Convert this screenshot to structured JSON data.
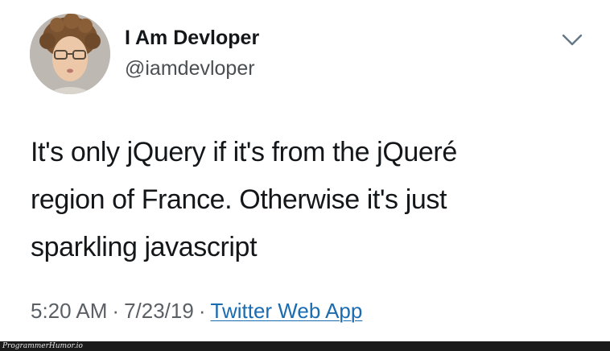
{
  "tweet": {
    "display_name": "I Am Devloper",
    "handle": "@iamdevloper",
    "text_lines": [
      "It's only jQuery if it's from the jQueré",
      "region of France. Otherwise it's just",
      "sparkling javascript"
    ],
    "time": "5:20 AM",
    "date": "7/23/19",
    "separator": "·",
    "source": "Twitter Web App",
    "avatar_icon": "profile-photo",
    "caret_icon": "chevron-down-icon"
  },
  "watermark": {
    "text": "ProgrammerHumor.io"
  },
  "colors": {
    "text": "#14171a",
    "secondary": "#5b6066",
    "link": "#1b6bb0",
    "watermark_bar": "#1a1a1a"
  }
}
